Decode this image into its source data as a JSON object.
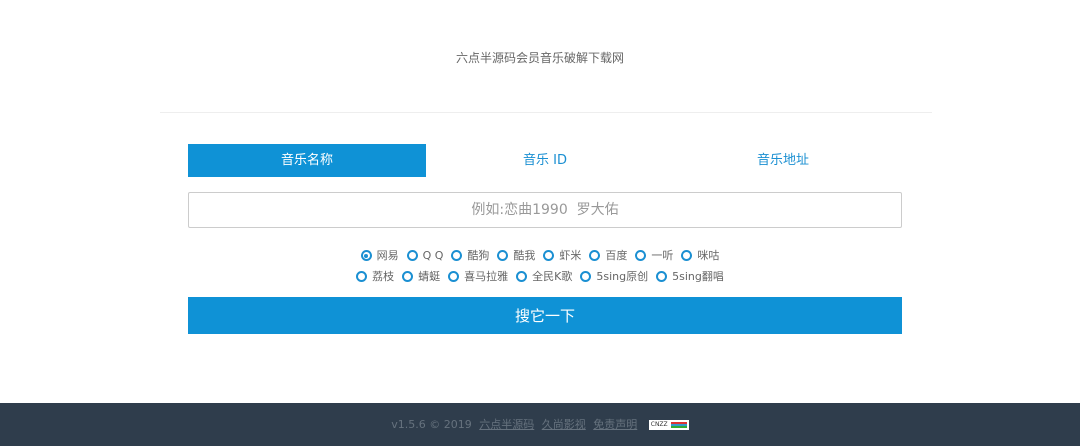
{
  "title": "六点半源码会员音乐破解下载网",
  "tabs": [
    "音乐名称",
    "音乐 ID",
    "音乐地址"
  ],
  "search": {
    "placeholder": "例如:恋曲1990  罗大佑",
    "value": ""
  },
  "sources_row1": [
    "网易",
    "Q Q",
    "酷狗",
    "酷我",
    "虾米",
    "百度",
    "一听",
    "咪咕"
  ],
  "sources_row2": [
    "荔枝",
    "蜻蜓",
    "喜马拉雅",
    "全民K歌",
    "5sing原创",
    "5sing翻唱"
  ],
  "selected_source": "网易",
  "submit_label": "搜它一下",
  "footer": {
    "prefix": "v1.5.6 © 2019",
    "links": [
      "六点半源码",
      "久尚影视",
      "免责声明"
    ],
    "badge": "CNZZ"
  }
}
